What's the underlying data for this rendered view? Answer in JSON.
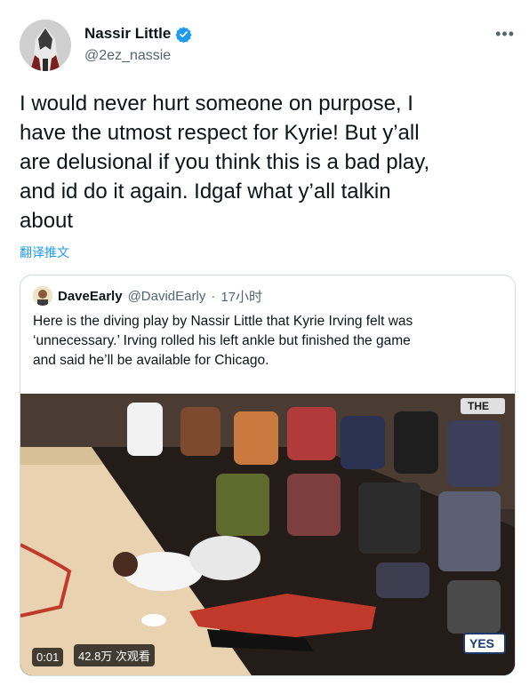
{
  "author": {
    "display_name": "Nassir Little",
    "handle": "@2ez_nassie",
    "verified_icon": "verified-badge-icon",
    "more_icon": "more-options-icon"
  },
  "tweet": {
    "text": "I would never hurt someone on purpose, I\nhave the utmost respect for Kyrie! But y’all\nare delusional if you think this is a bad play,\nand id do it again. Idgaf what y’all talkin\nabout",
    "translate_label": "翻译推文"
  },
  "quoted_tweet": {
    "display_name": "DaveEarly",
    "handle": "@DavidEarly",
    "separator": "·",
    "time": "17小时",
    "text": "Here is the diving play by Nassir Little that Kyrie Irving felt was\n‘unnecessary.’ Irving rolled his left ankle but finished the game\nand said he’ll be available for Chicago.",
    "media": {
      "timestamp": "0:01",
      "views": "42.8万 次观看",
      "network_logo": "YES",
      "corner_logo": "THE"
    }
  },
  "colors": {
    "link": "#1d9bf0",
    "secondary_text": "#536471",
    "border": "#cfd9de",
    "verified": "#1d9bf0"
  }
}
